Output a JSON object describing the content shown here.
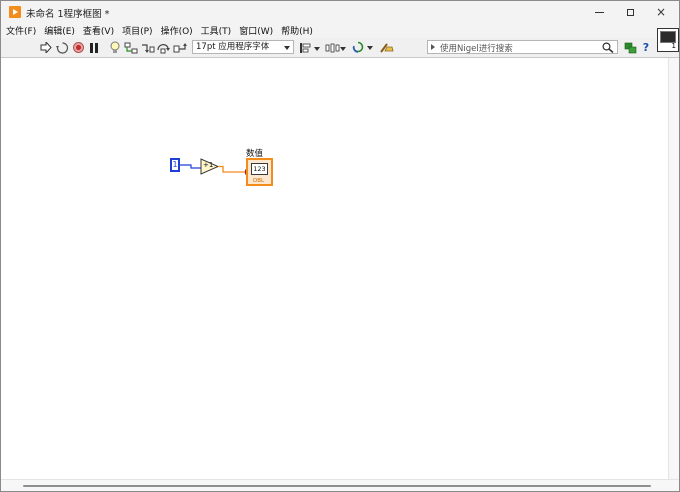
{
  "window": {
    "title": "未命名 1程序框图 *",
    "controls": {
      "minimize": "minimize-icon",
      "maximize": "maximize-icon",
      "close": "×"
    }
  },
  "menu": [
    "文件(F)",
    "编辑(E)",
    "查看(V)",
    "项目(P)",
    "操作(O)",
    "工具(T)",
    "窗口(W)",
    "帮助(H)"
  ],
  "toolbar": {
    "icons": [
      "run-arrow-icon",
      "run-continuously-icon",
      "abort-icon",
      "pause-icon",
      "highlight-execution-icon",
      "retain-wire-values-icon",
      "step-into-icon",
      "step-over-icon",
      "step-out-icon",
      "text-settings-dropdown"
    ],
    "font": "17pt 应用程序字体",
    "align_icon": "align-objects-icon",
    "distribute_icon": "distribute-objects-icon",
    "reorder_icon": "reorder-icon",
    "cleanup_icon": "clean-up-diagram-icon",
    "search_placeholder": "使用Nigel进行搜索",
    "help_icon": "?"
  },
  "connector_pane": {
    "number": "1"
  },
  "diagram": {
    "constant": {
      "value": "1"
    },
    "function": {
      "symbol": "+1",
      "name": "increment"
    },
    "indicator": {
      "label": "数值",
      "display": "123",
      "type": "DBL"
    },
    "accent": {
      "numeric_wire": "#1f3fd6",
      "dbl_wire": "#f28c1b"
    }
  }
}
